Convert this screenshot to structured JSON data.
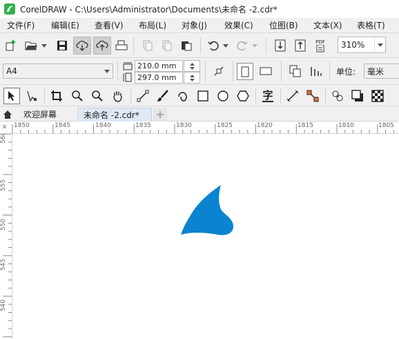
{
  "window": {
    "title": "CorelDRAW - C:\\Users\\Administrator\\Documents\\未命名 -2.cdr*",
    "logo_color": "#2fb24c"
  },
  "menu": {
    "items": [
      {
        "label": "文件(F)"
      },
      {
        "label": "编辑(E)"
      },
      {
        "label": "查看(V)"
      },
      {
        "label": "布局(L)"
      },
      {
        "label": "对象(J)"
      },
      {
        "label": "效果(C)"
      },
      {
        "label": "位图(B)"
      },
      {
        "label": "文本(X)"
      },
      {
        "label": "表格(T)"
      }
    ]
  },
  "standard_toolbar": {
    "zoom_level": "310%",
    "pdf_label": "PDF"
  },
  "property_bar": {
    "page_size": "A4",
    "width_value": "210.0 mm",
    "height_value": "297.0 mm",
    "units_label": "单位:",
    "units_value": "毫米"
  },
  "toolbox": {
    "text_tool_glyph": "字"
  },
  "tabs": [
    {
      "label": "欢迎屏幕"
    },
    {
      "label": "未命名 -2.cdr*"
    }
  ],
  "ruler_h": {
    "labels": [
      "1850",
      "1845",
      "1840",
      "1835",
      "1830",
      "1825",
      "1820",
      "1815",
      "1810",
      "1805"
    ]
  },
  "ruler_v": {
    "labels": [
      "560",
      "555",
      "550",
      "545",
      "540"
    ]
  },
  "canvas": {
    "shape_color": "#0a83d1"
  }
}
